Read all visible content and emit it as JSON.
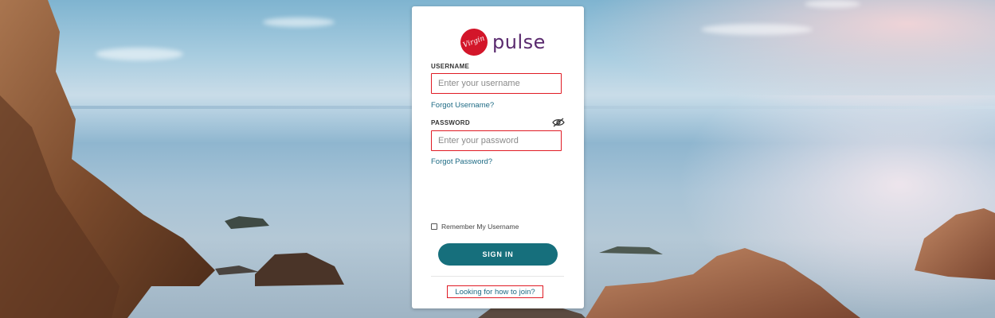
{
  "logo": {
    "badge_text": "Virgin",
    "wordmark": "pulse",
    "brand_red": "#d3162a",
    "brand_purple": "#5a2a6e"
  },
  "username": {
    "label": "USERNAME",
    "placeholder": "Enter your username",
    "value": "",
    "forgot_link": "Forgot Username?"
  },
  "password": {
    "label": "PASSWORD",
    "placeholder": "Enter your password",
    "value": "",
    "forgot_link": "Forgot Password?",
    "toggle_icon": "eye-slash-icon"
  },
  "remember": {
    "label": "Remember My Username",
    "checked": false
  },
  "signin": {
    "label": "SIGN IN",
    "color": "#166f7c"
  },
  "join_link": "Looking for how to join?",
  "colors": {
    "error_border": "#e01b24",
    "link": "#1d6a84"
  },
  "background": "seaside-rocks-photo"
}
